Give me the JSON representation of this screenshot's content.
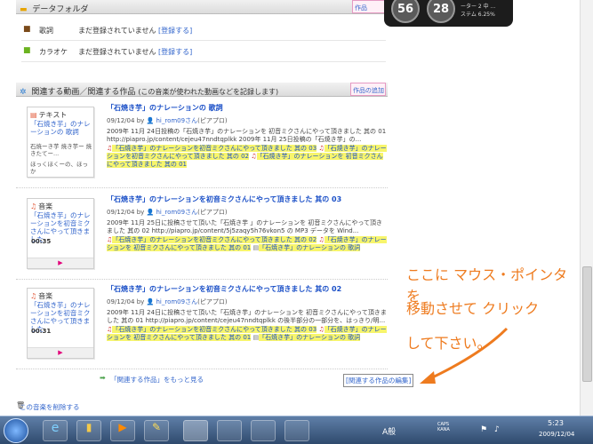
{
  "data_folder": {
    "title": "データフォルダ",
    "add_label": "作品",
    "rows": [
      {
        "label": "歌詞",
        "value": "まだ登録されていません",
        "link": "[登録する]"
      },
      {
        "label": "カラオケ",
        "value": "まだ登録されていません",
        "link": "[登録する]"
      }
    ]
  },
  "related": {
    "title": "関連する動画／関連する作品",
    "subtitle": "(この音楽が使われた動画などを記録します)",
    "add_label": "作品の追加",
    "items": [
      {
        "card_type": "テキスト",
        "card_title": "「石焼き芋」のナレーションの 歌詞",
        "card_body": "石焼ーき芋 焼き芋ー 焼きたてー...",
        "card_body2": "ほっくほくーの、ほっか",
        "title": "「石焼き芋」のナレーションの 歌詞",
        "date": "09/12/04",
        "by": "by",
        "user": "hi_rom09さん",
        "user_suffix": "(ピアプロ)",
        "desc": "2009年 11月 24日投稿の「石焼き芋」のナレーションを 初音ミクさんにやって頂きました 其の 01 http://piapro.jp/content/cejeu47nndtqplkk 2009年 11月 25日投稿の「石焼き芋」の...",
        "tags": [
          "「石焼き芋」のナレーションを初音ミクさんにやって頂きました 其の 03",
          "「石焼き芋」のナレーションを初音ミクさんにやって頂きました 其の 02",
          "「石焼き芋」のナレーションを 初音ミクさんにやって頂きました 其の 01"
        ]
      },
      {
        "card_type": "音楽",
        "card_title": "「石焼き芋」のナレーションを初音ミクさんにやって頂きました",
        "duration": "00:35",
        "title": "「石焼き芋」のナレーションを初音ミクさんにやって頂きました 其の 03",
        "date": "09/12/04",
        "by": "by",
        "user": "hi_rom09さん",
        "user_suffix": "(ピアプロ)",
        "desc": "2009年 11月 25日に投稿させて頂いた「石焼き芋 」のナレーションを 初音ミクさんにやって頂きました 其の 02 http://piapro.jp/content/5j5zaqy5h76vkon5 の MP3 データを Wind...",
        "tags": [
          "「石焼き芋」のナレーションを初音ミクさんにやって頂きました 其の 02",
          "「石焼き芋」のナレーションを 初音ミクさんにやって頂きました 其の 01",
          "「石焼き芋」のナレーションの 歌詞"
        ]
      },
      {
        "card_type": "音楽",
        "card_title": "「石焼き芋」のナレーションを初音ミクさんにやって頂きました",
        "duration": "00:31",
        "title": "「石焼き芋」のナレーションを初音ミクさんにやって頂きました 其の 02",
        "date": "09/12/04",
        "by": "by",
        "user": "hi_rom09さん",
        "user_suffix": "(ピアプロ)",
        "desc": "2009年 11月 24日に投稿させて頂いた「石焼き芋」のナレーションを 初音ミクさんにやって頂きました 其の 01 http://piapro.jp/content/cejeu47nndtqplkk の後半部分の一部分を、はっきり/明...",
        "tags": [
          "「石焼き芋」のナレーションを初音ミクさんにやって頂きました 其の 03",
          "「石焼き芋」のナレーションを 初音ミクさんにやって頂きました 其の 01",
          "「石焼き芋」のナレーションの 歌詞"
        ]
      }
    ],
    "more_link": "「関連する作品」をもっと見る",
    "edit_link": "[関連する作品の編集]",
    "delete_link": "この音楽を削除する"
  },
  "play_symbol": "▶",
  "callout": {
    "line1": "ここに マウス・ポインタ を",
    "line2": "移動させて クリック",
    "line3": "して下さい。"
  },
  "gadget": {
    "cpu": "56",
    "mem": "28",
    "label1": "ーター 2 中 ...",
    "label2": "ステム 6.25%"
  },
  "tray": {
    "time": "5:23",
    "date": "2009/12/04",
    "ime": "A般",
    "caps": "CAPS KANA"
  },
  "colors": {
    "link": "#3366cc",
    "tag_bg": "#f7f56c",
    "callout": "#ee7b1f",
    "taskbar": "#3d5a80"
  }
}
